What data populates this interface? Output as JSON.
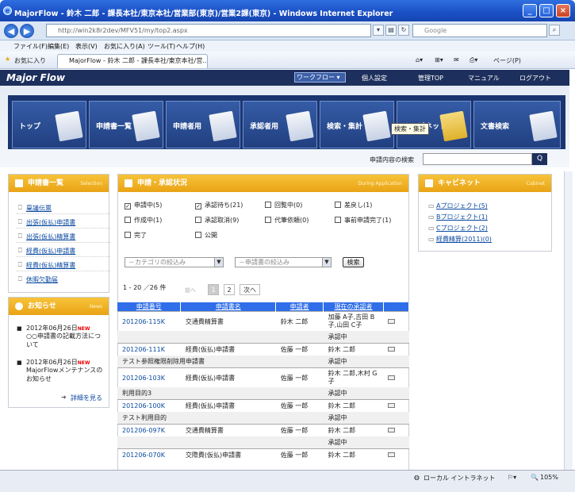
{
  "browser": {
    "title": "MajorFlow - 鈴木 二郎 - 課長本社/東京本社/営業部(東京)/営業2課(東京) - Windows Internet Explorer",
    "url": "http://win2k8r2dev/MFV51/my/top2.aspx",
    "search_placeholder": "Google",
    "menu": [
      "ファイル(F)",
      "編集(E)",
      "表示(V)",
      "お気に入り(A)",
      "ツール(T)",
      "ヘルプ(H)"
    ],
    "favorites_label": "お気に入り",
    "tab_title": "MajorFlow - 鈴木 二郎 - 課長本社/東京本社/営...",
    "page_menu": "ページ(P)",
    "status_zone": "ローカル イントラネット",
    "zoom": "105%"
  },
  "app": {
    "logo": "Major Flow",
    "workflow_select": "ワークフロー",
    "top_links": [
      "個人設定",
      "管理TOP",
      "マニュアル",
      "ログアウト"
    ],
    "nav": [
      "トップ",
      "申請書一覧",
      "申請者用",
      "承認者用",
      "検索・集計",
      "キャビネット",
      "文書検索"
    ],
    "tooltip": "検索・集計",
    "search_label": "申請内容の検索",
    "search_btn": "Q"
  },
  "left": {
    "title": "申請書一覧",
    "sub": "Selection",
    "items": [
      "稟議伝票",
      "出張(仮払)申請書",
      "出張(仮払)精算書",
      "経費(仮払)申請書",
      "経費(仮払)精算書",
      "休暇欠勤届"
    ]
  },
  "news": {
    "title": "お知らせ",
    "sub": "News",
    "items": [
      {
        "date": "2012年06月26日",
        "badge": "NEW",
        "text": "○○申請書の記載方法について"
      },
      {
        "date": "2012年06月26日",
        "badge": "NEW",
        "text": "MajorFlowメンテナンスのお知らせ"
      }
    ],
    "more": "詳細を見る"
  },
  "center": {
    "title": "申請・承認状況",
    "sub": "During Application",
    "filters": [
      {
        "label": "申請中(5)",
        "checked": true
      },
      {
        "label": "承認待ち(21)",
        "checked": true
      },
      {
        "label": "回覧中(0)",
        "checked": false
      },
      {
        "label": "差戻し(1)",
        "checked": false
      },
      {
        "label": "作成中(1)",
        "checked": false
      },
      {
        "label": "承認取消(9)",
        "checked": false
      },
      {
        "label": "代筆依頼(0)",
        "checked": false
      },
      {
        "label": "事前申請完了(1)",
        "checked": false
      },
      {
        "label": "完了",
        "checked": false
      },
      {
        "label": "公開",
        "checked": false
      }
    ],
    "category_placeholder": "－カテゴリの絞込み",
    "form_placeholder": "－申請書の絞込み",
    "search_btn": "検索",
    "count": "1 - 20 ／26 件",
    "prev": "前へ",
    "pages": [
      "1",
      "2"
    ],
    "next": "次へ",
    "columns": [
      "申請番号",
      "申請書名",
      "申請者",
      "現在の承認者"
    ],
    "rows": [
      {
        "id": "201206-115K",
        "form": "交通費精算書",
        "applicant": "鈴木 二郎",
        "approver": "加藤 A子,吉田 B子,山田 C子",
        "note": "",
        "status": "承認中"
      },
      {
        "id": "201206-111K",
        "form": "経費(仮払)申請書",
        "applicant": "佐藤 一郎",
        "approver": "鈴木 二郎",
        "note": "テスト参照権限削除用申請書",
        "status": "承認中"
      },
      {
        "id": "201206-103K",
        "form": "経費(仮払)申請書",
        "applicant": "佐藤 一郎",
        "approver": "鈴木 二郎,木村 G子",
        "note": "利用目的3",
        "status": "承認中"
      },
      {
        "id": "201206-100K",
        "form": "経費(仮払)申請書",
        "applicant": "佐藤 一郎",
        "approver": "鈴木 二郎",
        "note": "テスト利用目的",
        "status": "承認中"
      },
      {
        "id": "201206-097K",
        "form": "交通費精算書",
        "applicant": "佐藤 一郎",
        "approver": "鈴木 二郎",
        "note": "",
        "status": "承認中"
      },
      {
        "id": "201206-070K",
        "form": "交際費(仮払)申請書",
        "applicant": "佐藤 一郎",
        "approver": "鈴木 二郎",
        "note": "",
        "status": ""
      }
    ]
  },
  "right": {
    "title": "キャビネット",
    "sub": "Cabinet",
    "items": [
      "Aプロジェクト(5)",
      "Bプロジェクト(1)",
      "Cプロジェクト(2)",
      "経費精算(2011)(0)"
    ]
  }
}
